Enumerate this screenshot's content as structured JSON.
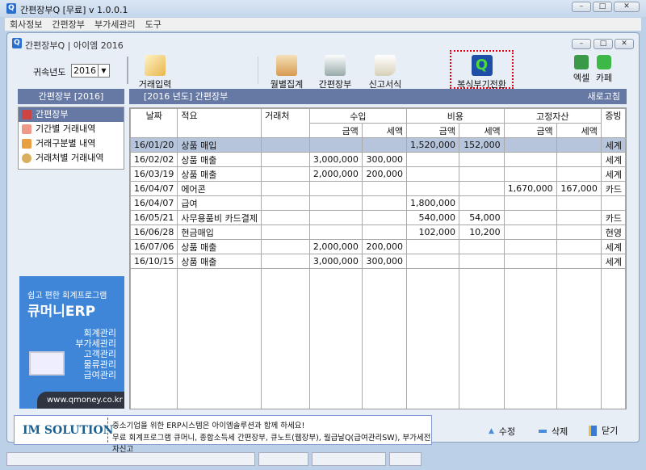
{
  "window": {
    "title": "간편장부Q  [무료] v 1.0.0.1",
    "inner_title": "간편장부Q | 아이엠 2016"
  },
  "menu": [
    "회사정보",
    "간편장부",
    "부가세관리",
    "도구"
  ],
  "toolbar": {
    "year_label": "귀속년도",
    "year_value": "2016",
    "buttons": {
      "entry": "거래입력",
      "monthly": "월별집계",
      "ledger": "간편장부",
      "report": "신고서식",
      "convert": "복식부기전환",
      "excel": "엑셀",
      "cafe": "카페"
    }
  },
  "left": {
    "header": "간편장부 [2016]",
    "items": [
      "간편장부",
      "기간별 거래내역",
      "거래구분별 내역",
      "거래처별 거래내역"
    ]
  },
  "main": {
    "header": "[2016 년도] 간편장부",
    "refresh": "새로고침"
  },
  "table": {
    "headers": {
      "date": "날짜",
      "desc": "적요",
      "partner": "거래처",
      "income": "수입",
      "expense": "비용",
      "asset": "고정자산",
      "amount": "금액",
      "tax": "세액",
      "evidence": "증빙"
    },
    "rows": [
      [
        "16/01/20",
        "상품 매입",
        "",
        "",
        "",
        "1,520,000",
        "152,000",
        "",
        "",
        "세계"
      ],
      [
        "16/02/02",
        "상품 매출",
        "",
        "3,000,000",
        "300,000",
        "",
        "",
        "",
        "",
        "세계"
      ],
      [
        "16/03/19",
        "상품 매출",
        "",
        "2,000,000",
        "200,000",
        "",
        "",
        "",
        "",
        "세계"
      ],
      [
        "16/04/07",
        "에어콘",
        "",
        "",
        "",
        "",
        "",
        "1,670,000",
        "167,000",
        "카드"
      ],
      [
        "16/04/07",
        "급여",
        "",
        "",
        "",
        "1,800,000",
        "",
        "",
        "",
        ""
      ],
      [
        "16/05/21",
        "사무용품비 카드결제",
        "",
        "",
        "",
        "540,000",
        "54,000",
        "",
        "",
        "카드"
      ],
      [
        "16/06/28",
        "현금매입",
        "",
        "",
        "",
        "102,000",
        "10,200",
        "",
        "",
        "현영"
      ],
      [
        "16/07/06",
        "상품 매출",
        "",
        "2,000,000",
        "200,000",
        "",
        "",
        "",
        "",
        "세계"
      ],
      [
        "16/10/15",
        "상품 매출",
        "",
        "3,000,000",
        "300,000",
        "",
        "",
        "",
        "",
        "세계"
      ]
    ]
  },
  "ad": {
    "tagline": "쉽고 편한 회계프로그램",
    "product": "큐머니ERP",
    "features": [
      "회계관리",
      "부가세관리",
      "고객관리",
      "물류관리",
      "급여관리"
    ],
    "url": "www.qmoney.co.kr"
  },
  "banner": {
    "logo": "IM SOLUTION",
    "line1": "중소기업을 위한 ERP시스템은 아이엠솔루션과 함께 하세요!",
    "line2": "무료 회계프로그램 큐머니, 종합소득세 간편장부, 큐노트(웹장부), 월급날Q(급여관리SW), 부가세전자신고"
  },
  "actions": {
    "edit": "수정",
    "delete": "삭제",
    "close": "닫기"
  }
}
